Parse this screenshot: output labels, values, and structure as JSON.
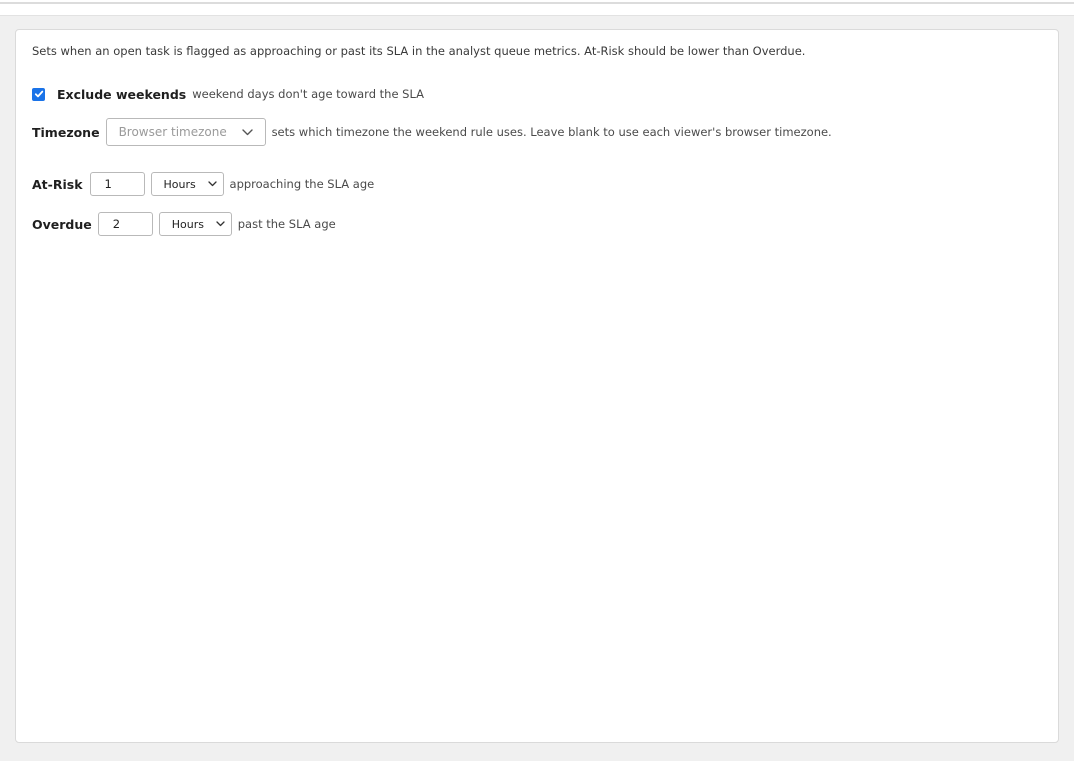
{
  "description": "Sets when an open task is flagged as approaching or past its SLA in the analyst queue metrics. At-Risk should be lower than Overdue.",
  "weekends": {
    "checked": true,
    "label": "Exclude weekends",
    "hint": "weekend days don't age toward the SLA"
  },
  "timezone": {
    "label": "Timezone",
    "placeholder": "Browser timezone",
    "hint": "sets which timezone the weekend rule uses. Leave blank to use each viewer's browser timezone."
  },
  "at_risk": {
    "label": "At-Risk",
    "value": "1",
    "unit": "Hours",
    "hint": "approaching the SLA age"
  },
  "overdue": {
    "label": "Overdue",
    "value": "2",
    "unit": "Hours",
    "hint": "past the SLA age"
  },
  "colors": {
    "accent": "#1a73e8",
    "border": "#b9b9b9",
    "background": "#f0f0f0"
  }
}
